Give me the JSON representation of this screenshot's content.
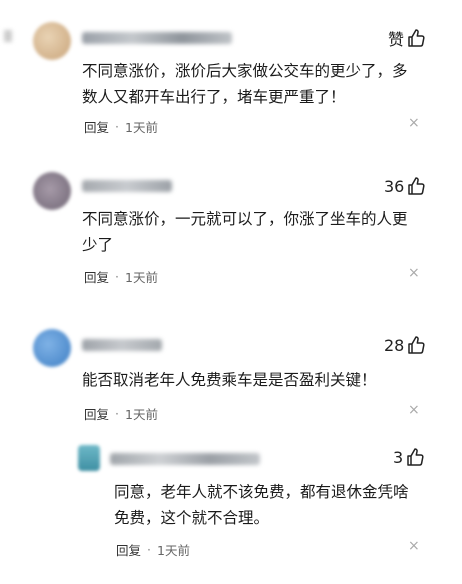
{
  "comments": [
    {
      "like_label": "赞",
      "text_line1": "不同意涨价，涨价后大家做公交车的更少了，多",
      "text_line2": "数人又都开车出行了，堵车更严重了！",
      "reply": "回复",
      "sep": "·",
      "time": "1天前",
      "close": "×"
    },
    {
      "like_count": "36",
      "text_line1": "不同意涨价，一元就可以了，你涨了坐车的人更",
      "text_line2": "少了",
      "reply": "回复",
      "sep": "·",
      "time": "1天前",
      "close": "×"
    },
    {
      "like_count": "28",
      "text_line1": "能否取消老年人免费乘车是是否盈利关键！",
      "reply": "回复",
      "sep": "·",
      "time": "1天前",
      "close": "×"
    }
  ],
  "reply_comment": {
    "like_count": "3",
    "text_line1": "同意，老年人就不该免费，都有退休金凭啥",
    "text_line2": "免费，这个就不合理。",
    "reply": "回复",
    "sep": "·",
    "time": "1天前",
    "close": "×"
  },
  "icons": {
    "like": "thumbs-up-icon",
    "close": "close-icon",
    "avatar": "avatar"
  }
}
